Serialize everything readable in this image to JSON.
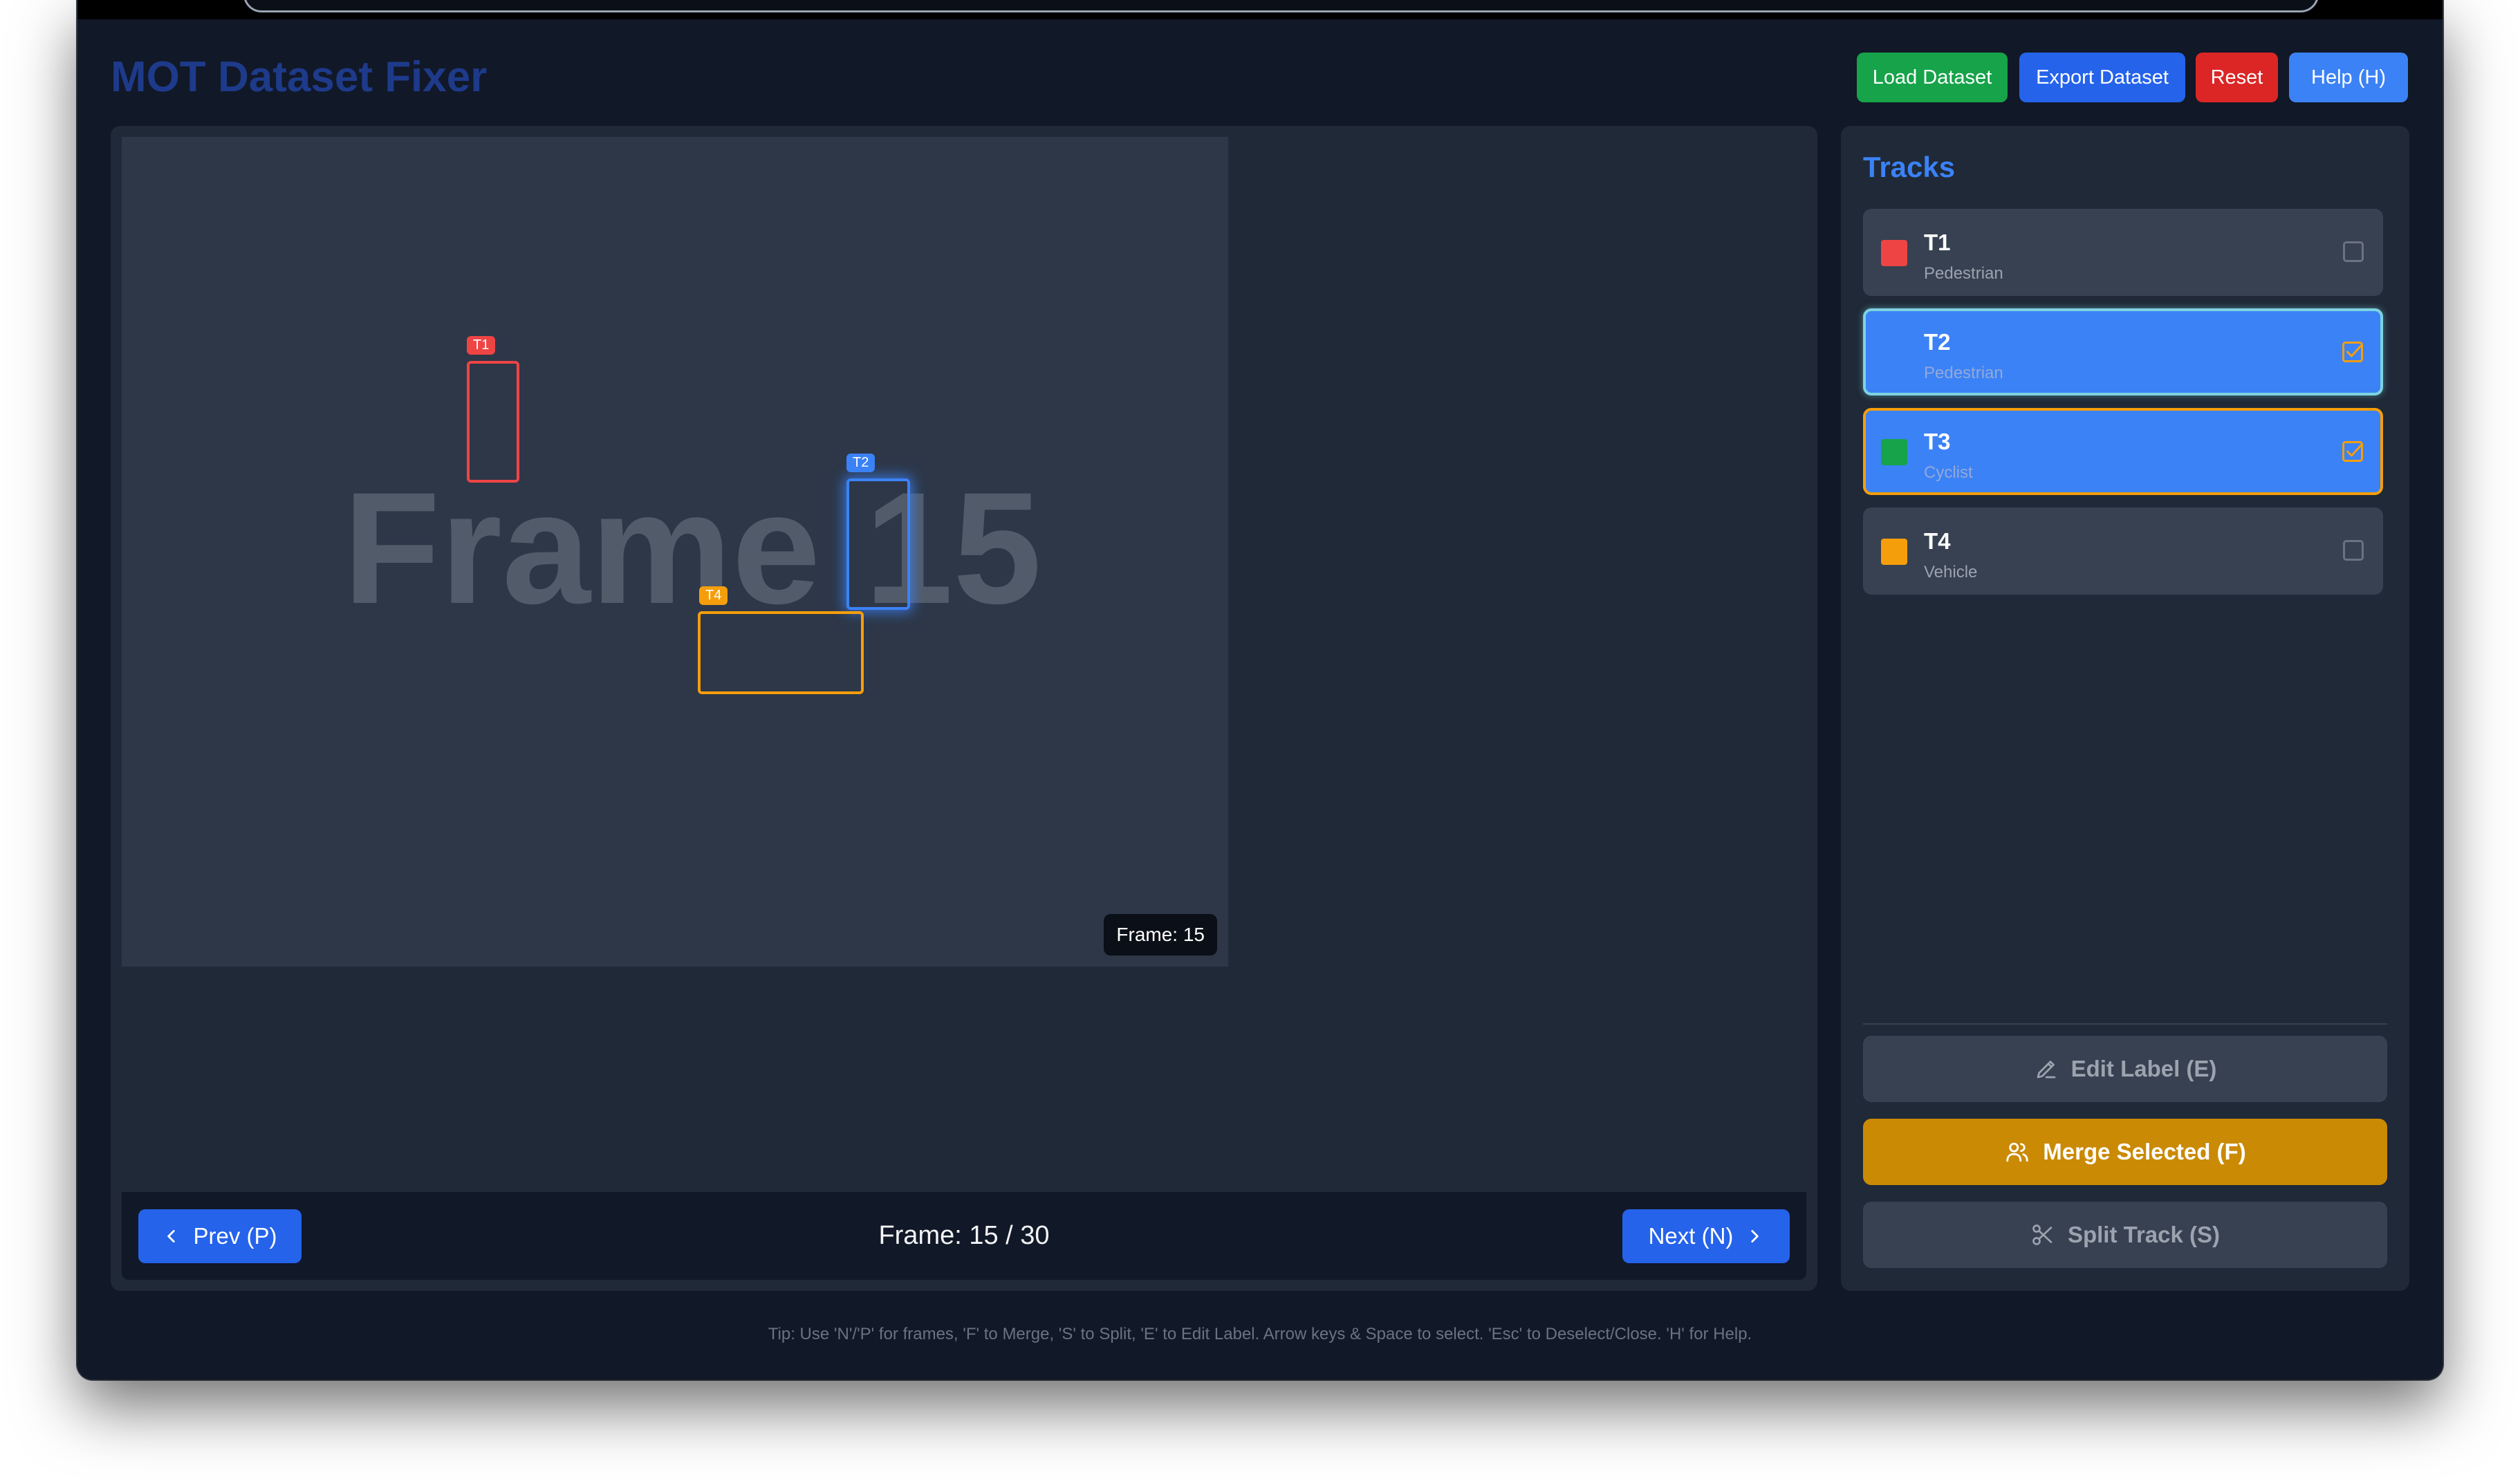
{
  "app": {
    "title": "MOT Dataset Fixer"
  },
  "header": {
    "buttons": [
      {
        "label": "Load Dataset",
        "color": "#16a34a"
      },
      {
        "label": "Export Dataset",
        "color": "#2563eb"
      },
      {
        "label": "Reset",
        "color": "#dc2626"
      },
      {
        "label": "Help (H)",
        "color": "#3b82f6"
      }
    ]
  },
  "canvas": {
    "watermark": "Frame 15",
    "frame_badge": "Frame: 15",
    "boxes": [
      {
        "tag": "T1",
        "color": "#ef4444"
      },
      {
        "tag": "T2",
        "color": "#3b82f6"
      },
      {
        "tag": "T4",
        "color": "#f59e0b"
      }
    ]
  },
  "nav": {
    "prev_label": "Prev (P)",
    "next_label": "Next (N)",
    "frame_counter": "Frame: 15 / 30"
  },
  "sidebar": {
    "title": "Tracks",
    "tracks": [
      {
        "id": "T1",
        "class": "Pedestrian",
        "color": "#ef4444",
        "selected": false
      },
      {
        "id": "T2",
        "class": "Pedestrian",
        "color": "#3b82f6",
        "selected": true
      },
      {
        "id": "T3",
        "class": "Cyclist",
        "color": "#16a34a",
        "selected": true
      },
      {
        "id": "T4",
        "class": "Vehicle",
        "color": "#f59e0b",
        "selected": false
      }
    ],
    "actions": {
      "edit_label": "Edit Label (E)",
      "merge_label": "Merge Selected (F)",
      "split_label": "Split Track (S)"
    }
  },
  "footer": {
    "tip": "Tip: Use 'N'/'P' for frames, 'F' to Merge, 'S' to Split, 'E' to Edit Label. Arrow keys & Space to select. 'Esc' to Deselect/Close. 'H' for Help."
  }
}
